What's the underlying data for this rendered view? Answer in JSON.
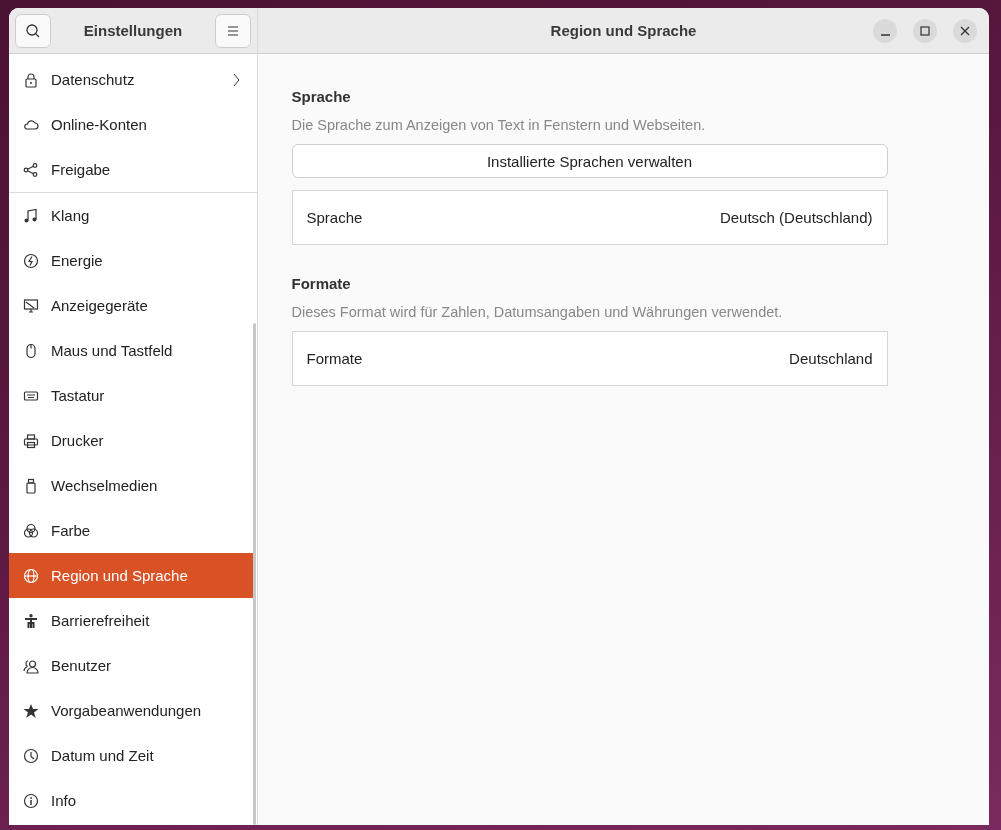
{
  "sidebar": {
    "title": "Einstellungen",
    "groups": [
      {
        "items": [
          {
            "label": "Datenschutz",
            "selected": false,
            "has_submenu": true
          },
          {
            "label": "Online-Konten",
            "selected": false,
            "has_submenu": false
          },
          {
            "label": "Freigabe",
            "selected": false,
            "has_submenu": false
          }
        ]
      },
      {
        "items": [
          {
            "label": "Klang",
            "selected": false,
            "has_submenu": false
          },
          {
            "label": "Energie",
            "selected": false,
            "has_submenu": false
          },
          {
            "label": "Anzeigegeräte",
            "selected": false,
            "has_submenu": false
          },
          {
            "label": "Maus und Tastfeld",
            "selected": false,
            "has_submenu": false
          },
          {
            "label": "Tastatur",
            "selected": false,
            "has_submenu": false
          },
          {
            "label": "Drucker",
            "selected": false,
            "has_submenu": false
          },
          {
            "label": "Wechselmedien",
            "selected": false,
            "has_submenu": false
          },
          {
            "label": "Farbe",
            "selected": false,
            "has_submenu": false
          },
          {
            "label": "Region und Sprache",
            "selected": true,
            "has_submenu": false
          },
          {
            "label": "Barrierefreiheit",
            "selected": false,
            "has_submenu": false
          },
          {
            "label": "Benutzer",
            "selected": false,
            "has_submenu": false
          },
          {
            "label": "Vorgabeanwendungen",
            "selected": false,
            "has_submenu": false
          },
          {
            "label": "Datum und Zeit",
            "selected": false,
            "has_submenu": false
          },
          {
            "label": "Info",
            "selected": false,
            "has_submenu": false
          }
        ]
      }
    ]
  },
  "window": {
    "title": "Region und Sprache"
  },
  "sections": [
    {
      "heading": "Sprache",
      "description": "Die Sprache zum Anzeigen von Text in Fenstern und Webseiten.",
      "button": "Installierte Sprachen verwalten",
      "rows": [
        {
          "label": "Sprache",
          "value": "Deutsch (Deutschland)"
        }
      ]
    },
    {
      "heading": "Formate",
      "description": "Dieses Format wird für Zahlen, Datumsangaben und Währungen verwendet.",
      "rows": [
        {
          "label": "Formate",
          "value": "Deutschland"
        }
      ]
    }
  ]
}
